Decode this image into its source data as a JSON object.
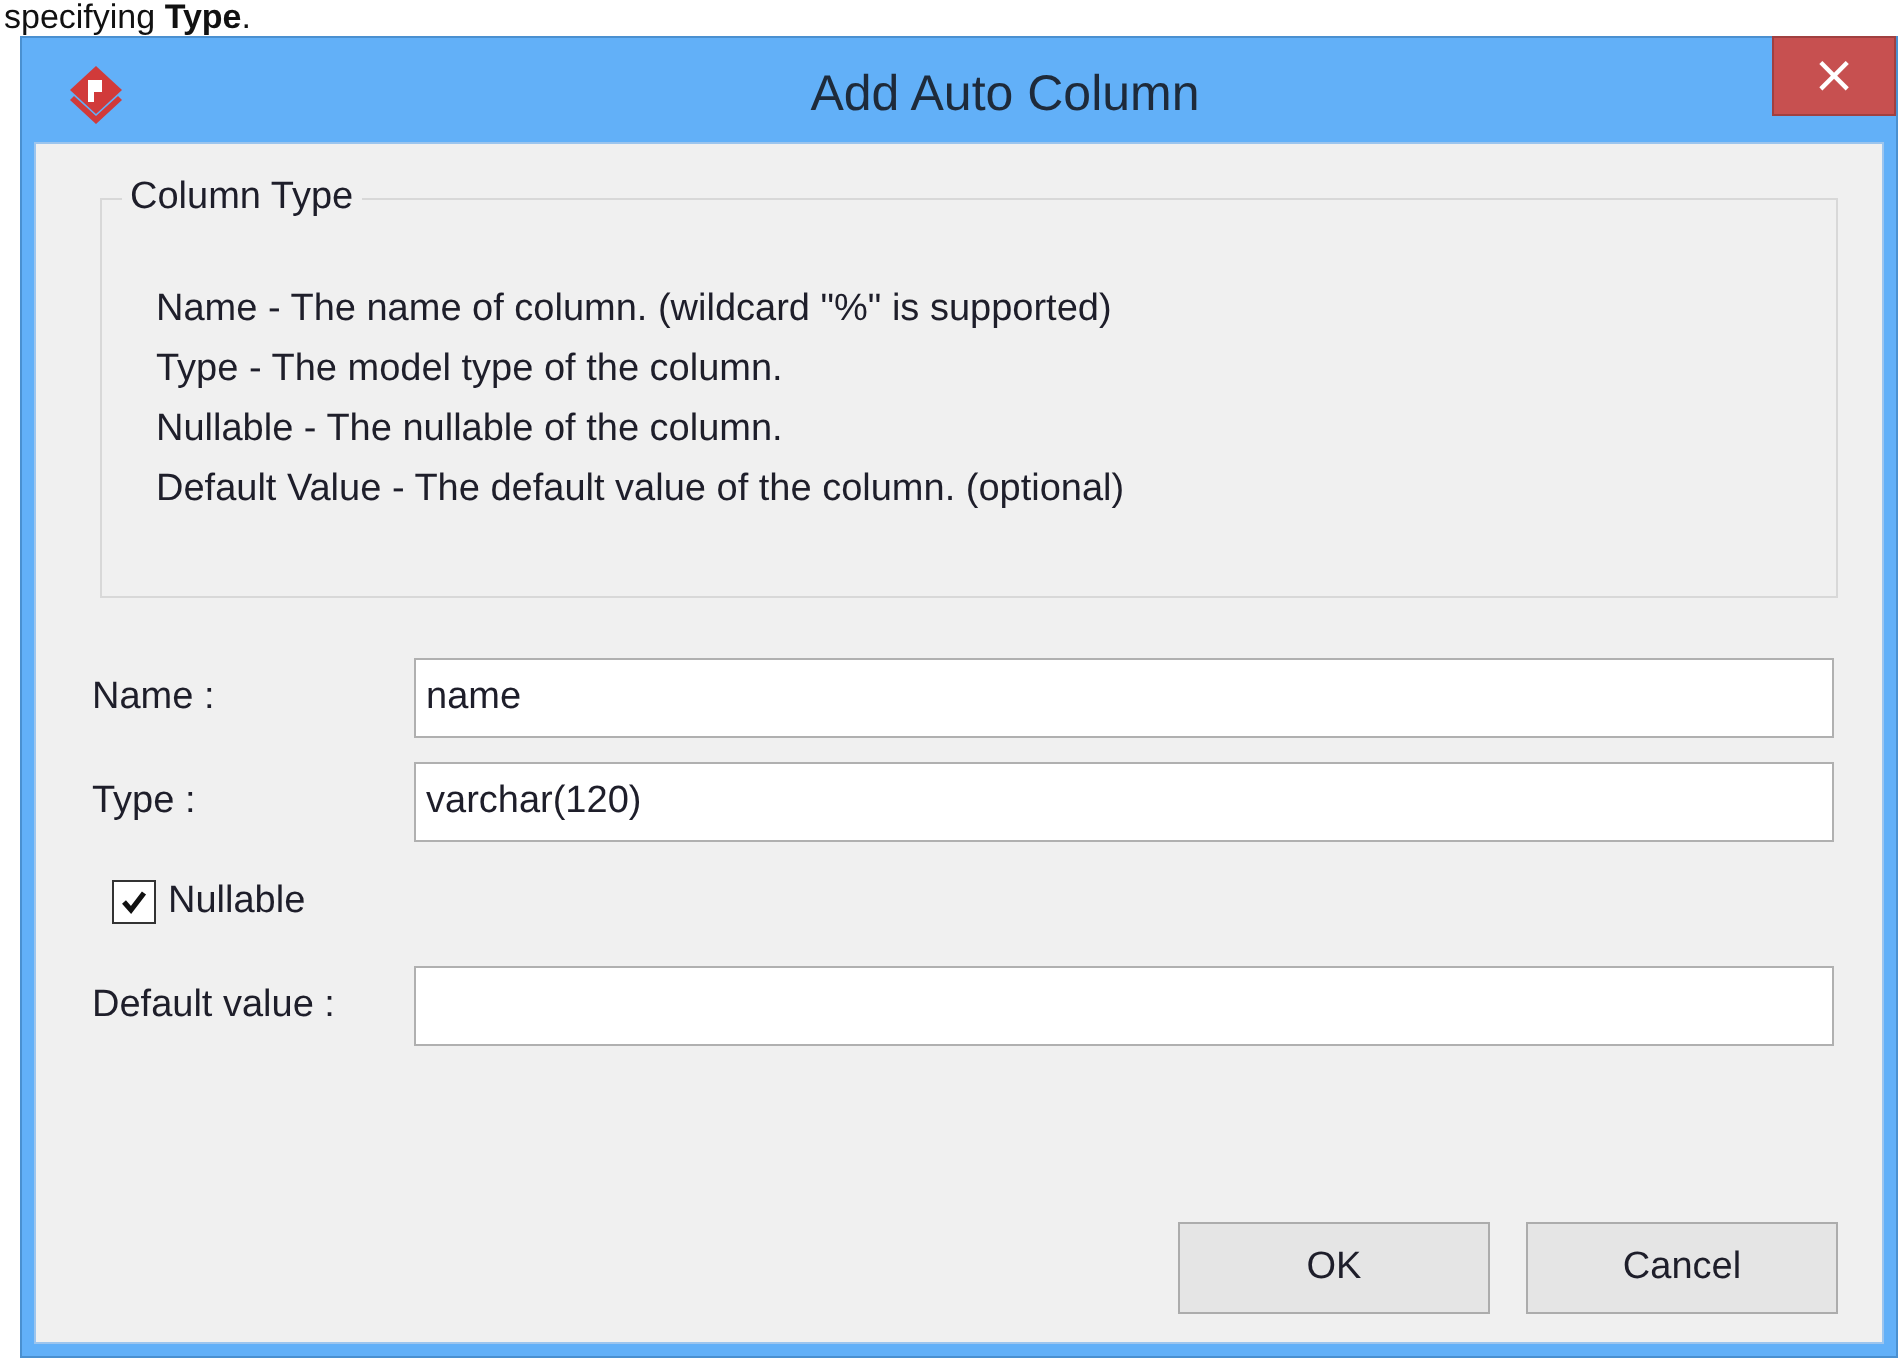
{
  "caption": "specifying **Type**.",
  "window": {
    "title": "Add Auto Column",
    "close": "×"
  },
  "group": {
    "title": "Column Type",
    "lines": [
      "Name - The name of column. (wildcard \"%\" is supported)",
      "Type - The model type of the column.",
      "Nullable - The nullable of the column.",
      "Default Value - The default value of the column. (optional)"
    ]
  },
  "fields": [
    {
      "label": "Name :",
      "value": "name"
    },
    {
      "label": "Type :",
      "value": "varchar(120)"
    }
  ],
  "nullable": {
    "label": "Nullable",
    "checked": true
  },
  "default_value": {
    "label": "Default value :"
  },
  "buttons": [
    "OK",
    "Cancel"
  ]
}
